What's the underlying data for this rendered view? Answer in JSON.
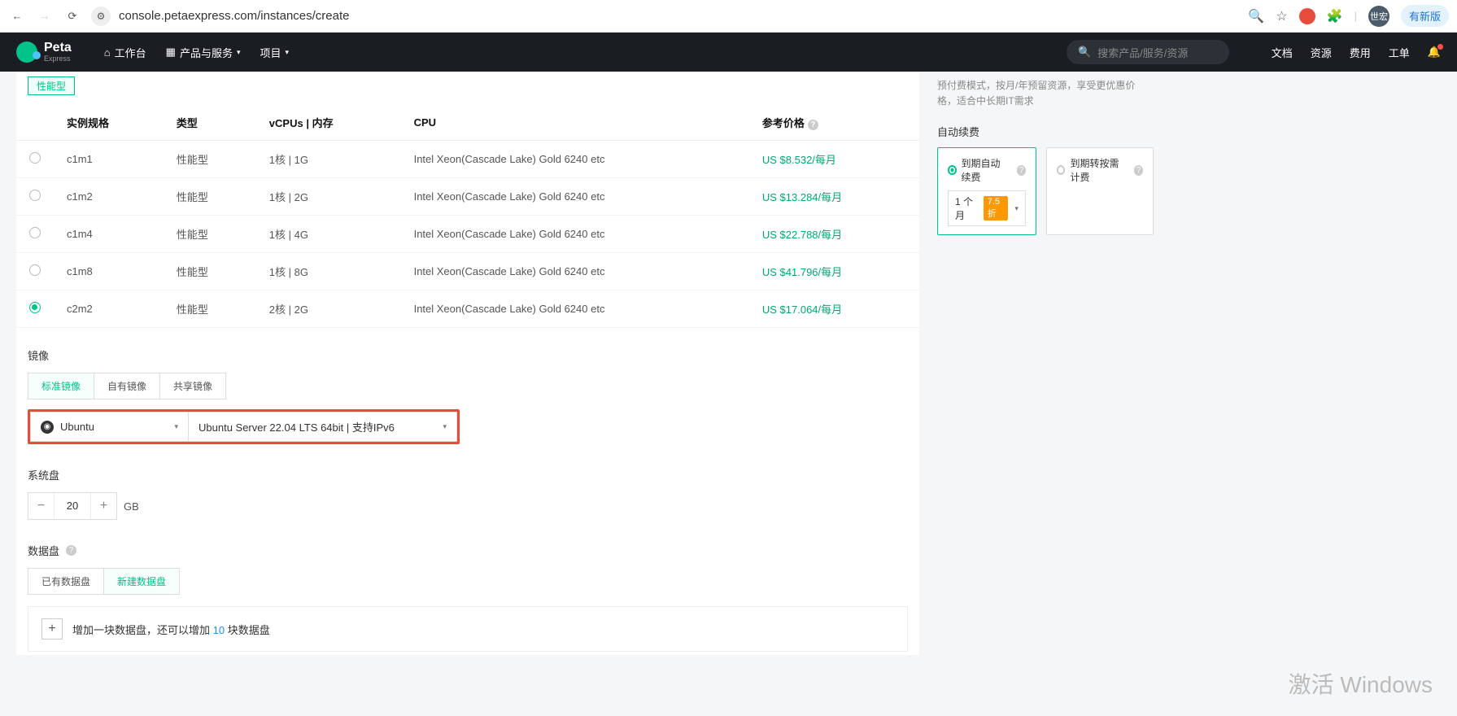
{
  "browser": {
    "url": "console.petaexpress.com/instances/create",
    "update_label": "有新版",
    "avatar_text": "世宏"
  },
  "nav": {
    "brand": "Peta",
    "brand_sub": "Express",
    "workspace": "工作台",
    "products": "产品与服务",
    "project": "项目",
    "search_placeholder": "搜索产品/服务/资源",
    "docs": "文档",
    "resources": "资源",
    "billing": "费用",
    "tickets": "工单"
  },
  "spec_tag": "性能型",
  "table": {
    "headers": {
      "spec": "实例规格",
      "type": "类型",
      "vcpu": "vCPUs | 内存",
      "cpu": "CPU",
      "price": "参考价格"
    },
    "rows": [
      {
        "spec": "c1m1",
        "type": "性能型",
        "vcpu": "1核 | 1G",
        "cpu": "Intel Xeon(Cascade Lake) Gold 6240 etc",
        "price": "US $8.532/每月",
        "selected": false
      },
      {
        "spec": "c1m2",
        "type": "性能型",
        "vcpu": "1核 | 2G",
        "cpu": "Intel Xeon(Cascade Lake) Gold 6240 etc",
        "price": "US $13.284/每月",
        "selected": false
      },
      {
        "spec": "c1m4",
        "type": "性能型",
        "vcpu": "1核 | 4G",
        "cpu": "Intel Xeon(Cascade Lake) Gold 6240 etc",
        "price": "US $22.788/每月",
        "selected": false
      },
      {
        "spec": "c1m8",
        "type": "性能型",
        "vcpu": "1核 | 8G",
        "cpu": "Intel Xeon(Cascade Lake) Gold 6240 etc",
        "price": "US $41.796/每月",
        "selected": false
      },
      {
        "spec": "c2m2",
        "type": "性能型",
        "vcpu": "2核 | 2G",
        "cpu": "Intel Xeon(Cascade Lake) Gold 6240 etc",
        "price": "US $17.064/每月",
        "selected": true
      }
    ]
  },
  "image": {
    "title": "镜像",
    "tabs": {
      "standard": "标准镜像",
      "own": "自有镜像",
      "shared": "共享镜像"
    },
    "os": "Ubuntu",
    "version": "Ubuntu Server 22.04 LTS 64bit | 支持IPv6"
  },
  "sysdisk": {
    "title": "系统盘",
    "value": "20",
    "unit": "GB"
  },
  "datadisk": {
    "title": "数据盘",
    "tabs": {
      "existing": "已有数据盘",
      "new": "新建数据盘"
    },
    "add_prefix": "增加一块数据盘，还可以增加 ",
    "add_count": "10",
    "add_suffix": " 块数据盘"
  },
  "side": {
    "prepay_note": "预付费模式，按月/年预留资源，享受更优惠价格，适合中长期IT需求",
    "auto_renew_title": "自动续费",
    "opt1": "到期自动续费",
    "opt2": "到期转按需计费",
    "duration": "1 个月",
    "discount": "7.5折"
  },
  "watermark": "激活 Windows"
}
